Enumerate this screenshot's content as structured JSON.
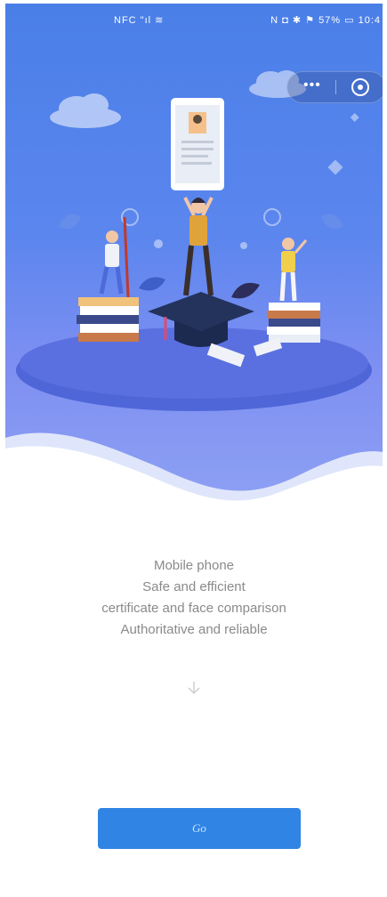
{
  "status_bar": {
    "left": "NFC \"ıl ≋",
    "right": "N ◘ ✱ ⚑ 57% ▭ 10:4"
  },
  "capsule": {
    "more_icon": "more-dots-icon",
    "target_icon": "record-target-icon"
  },
  "intro_lines": [
    "Mobile phone",
    "Safe and efficient",
    "certificate and face comparison",
    "Authoritative and reliable"
  ],
  "scroll_hint_icon": "arrow-down-icon",
  "go_button_label": "Go",
  "colors": {
    "hero_top": "#4a7fe8",
    "hero_bottom": "#8fa2f3",
    "button": "#2f84e4",
    "text": "#8a8a8a"
  }
}
